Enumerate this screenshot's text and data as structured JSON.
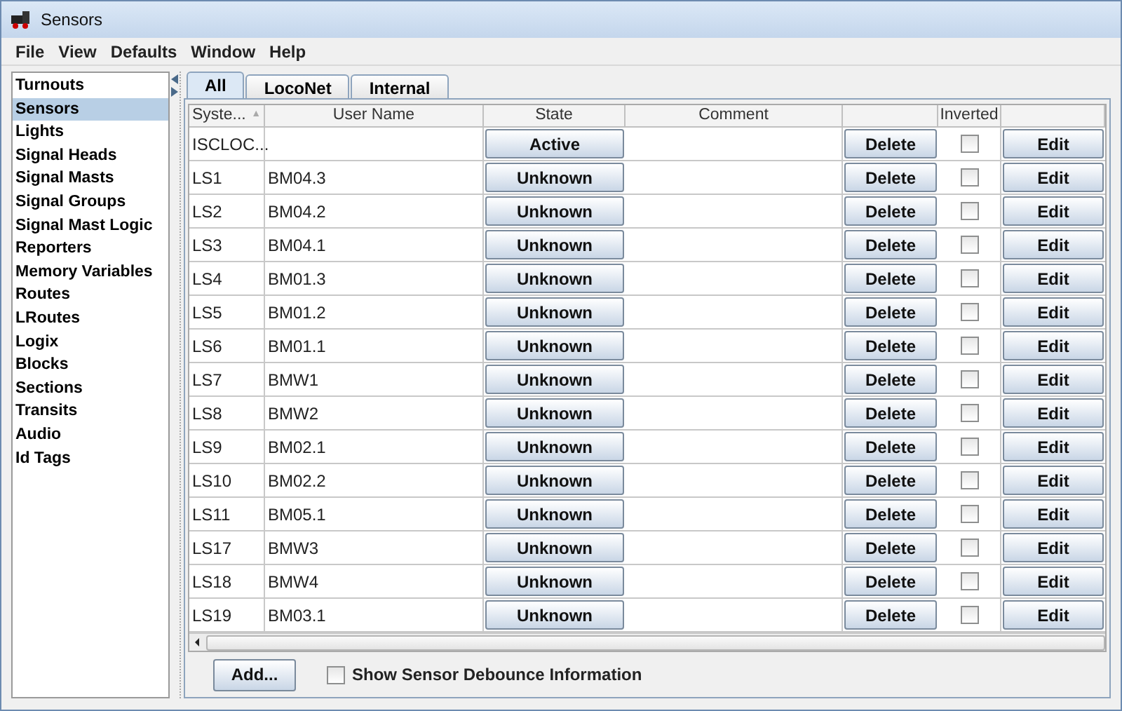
{
  "window": {
    "title": "Sensors"
  },
  "menu": [
    "File",
    "View",
    "Defaults",
    "Window",
    "Help"
  ],
  "sidebar": {
    "items": [
      {
        "label": "Turnouts",
        "selected": false
      },
      {
        "label": "Sensors",
        "selected": true
      },
      {
        "label": "Lights",
        "selected": false
      },
      {
        "label": "Signal Heads",
        "selected": false
      },
      {
        "label": "Signal Masts",
        "selected": false
      },
      {
        "label": "Signal Groups",
        "selected": false
      },
      {
        "label": "Signal Mast Logic",
        "selected": false
      },
      {
        "label": "Reporters",
        "selected": false
      },
      {
        "label": "Memory Variables",
        "selected": false
      },
      {
        "label": "Routes",
        "selected": false
      },
      {
        "label": "LRoutes",
        "selected": false
      },
      {
        "label": "Logix",
        "selected": false
      },
      {
        "label": "Blocks",
        "selected": false
      },
      {
        "label": "Sections",
        "selected": false
      },
      {
        "label": "Transits",
        "selected": false
      },
      {
        "label": "Audio",
        "selected": false
      },
      {
        "label": "Id Tags",
        "selected": false
      }
    ]
  },
  "tabs": [
    {
      "label": "All",
      "selected": true
    },
    {
      "label": "LocoNet",
      "selected": false
    },
    {
      "label": "Internal",
      "selected": false
    }
  ],
  "table": {
    "columns": [
      "Syste...",
      "User Name",
      "State",
      "Comment",
      "Inverted"
    ],
    "sort_mark": "▲",
    "rows": [
      {
        "system": "ISCLOC...",
        "user_name": "",
        "state": "Active",
        "delete": "Delete",
        "inverted": false,
        "edit": "Edit"
      },
      {
        "system": "LS1",
        "user_name": "BM04.3",
        "state": "Unknown",
        "delete": "Delete",
        "inverted": false,
        "edit": "Edit"
      },
      {
        "system": "LS2",
        "user_name": "BM04.2",
        "state": "Unknown",
        "delete": "Delete",
        "inverted": false,
        "edit": "Edit"
      },
      {
        "system": "LS3",
        "user_name": "BM04.1",
        "state": "Unknown",
        "delete": "Delete",
        "inverted": false,
        "edit": "Edit"
      },
      {
        "system": "LS4",
        "user_name": "BM01.3",
        "state": "Unknown",
        "delete": "Delete",
        "inverted": false,
        "edit": "Edit"
      },
      {
        "system": "LS5",
        "user_name": "BM01.2",
        "state": "Unknown",
        "delete": "Delete",
        "inverted": false,
        "edit": "Edit"
      },
      {
        "system": "LS6",
        "user_name": "BM01.1",
        "state": "Unknown",
        "delete": "Delete",
        "inverted": false,
        "edit": "Edit"
      },
      {
        "system": "LS7",
        "user_name": "BMW1",
        "state": "Unknown",
        "delete": "Delete",
        "inverted": false,
        "edit": "Edit"
      },
      {
        "system": "LS8",
        "user_name": "BMW2",
        "state": "Unknown",
        "delete": "Delete",
        "inverted": false,
        "edit": "Edit"
      },
      {
        "system": "LS9",
        "user_name": "BM02.1",
        "state": "Unknown",
        "delete": "Delete",
        "inverted": false,
        "edit": "Edit"
      },
      {
        "system": "LS10",
        "user_name": "BM02.2",
        "state": "Unknown",
        "delete": "Delete",
        "inverted": false,
        "edit": "Edit"
      },
      {
        "system": "LS11",
        "user_name": "BM05.1",
        "state": "Unknown",
        "delete": "Delete",
        "inverted": false,
        "edit": "Edit"
      },
      {
        "system": "LS17",
        "user_name": "BMW3",
        "state": "Unknown",
        "delete": "Delete",
        "inverted": false,
        "edit": "Edit"
      },
      {
        "system": "LS18",
        "user_name": "BMW4",
        "state": "Unknown",
        "delete": "Delete",
        "inverted": false,
        "edit": "Edit"
      },
      {
        "system": "LS19",
        "user_name": "BM03.1",
        "state": "Unknown",
        "delete": "Delete",
        "inverted": false,
        "edit": "Edit"
      }
    ]
  },
  "footer": {
    "add_button": "Add...",
    "debounce": {
      "label": "Show Sensor Debounce Information",
      "checked": false
    }
  }
}
